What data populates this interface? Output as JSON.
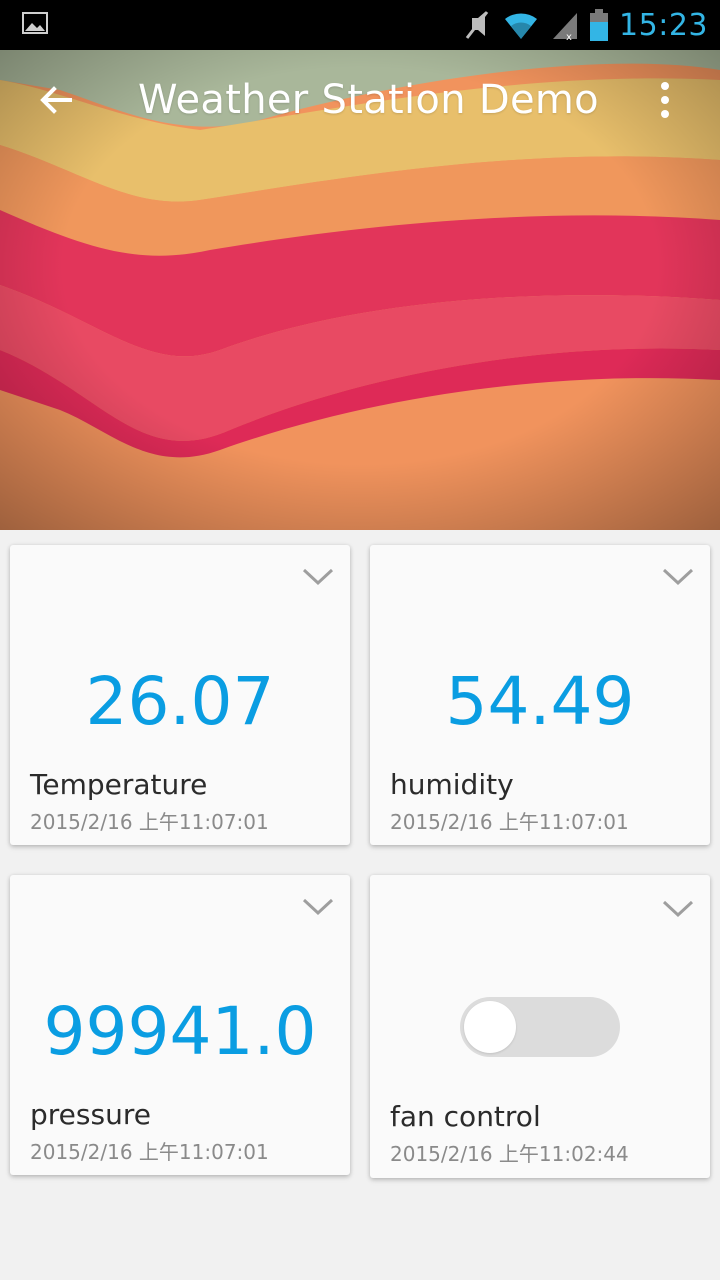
{
  "status_bar": {
    "time": "15:23",
    "icons": [
      "gallery-icon",
      "mute-icon",
      "wifi-icon",
      "cell-signal-icon",
      "battery-icon"
    ],
    "time_color": "#33b5e5"
  },
  "app_bar": {
    "title": "Weather Station Demo",
    "back_icon": "arrow-left-icon",
    "menu_icon": "more-vert-icon"
  },
  "cards": [
    {
      "label": "Temperature",
      "value": "26.07",
      "timestamp": "2015/2/16 上午11:07:01"
    },
    {
      "label": "humidity",
      "value": "54.49",
      "timestamp": "2015/2/16 上午11:07:01"
    },
    {
      "label": "pressure",
      "value": "99941.0",
      "timestamp": "2015/2/16 上午11:07:01"
    },
    {
      "label": "fan control",
      "toggle_on": false,
      "timestamp": "2015/2/16 上午11:02:44"
    }
  ],
  "colors": {
    "value_blue": "#0a9de2",
    "card_bg": "#fafafa",
    "page_bg": "#f1f1f1"
  }
}
